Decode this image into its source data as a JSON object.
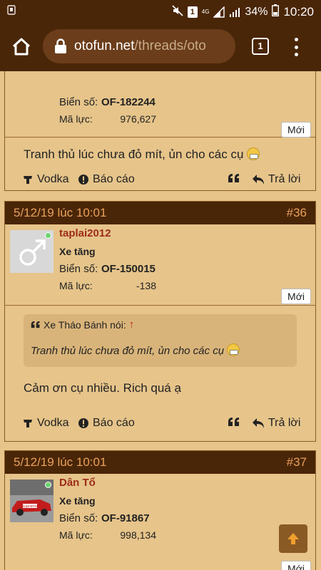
{
  "status": {
    "battery": "34%",
    "time": "10:20",
    "notif_count": "1",
    "network": "4G"
  },
  "browser": {
    "url_host": "otofun.net",
    "url_path": "/threads/oto",
    "tab_count": "1"
  },
  "posts": [
    {
      "plate_label": "Biển số:",
      "plate": "OF-182244",
      "hp_label": "Mã lực:",
      "hp": "976,627",
      "new_badge": "Mới",
      "message": "Tranh thủ lúc chưa đỏ mít, ủn cho các cụ",
      "vodka": "Vodka",
      "report": "Báo cáo",
      "reply": "Trả lời"
    },
    {
      "date": "5/12/19 lúc 10:01",
      "num": "#36",
      "username": "taplai2012",
      "title": "Xe tăng",
      "plate_label": "Biển số:",
      "plate": "OF-150015",
      "hp_label": "Mã lực:",
      "hp": "-138",
      "new_badge": "Mới",
      "quote_author": "Xe Tháo Bánh nói:",
      "quote_text": "Tranh thủ lúc chưa đỏ mít, ủn cho các cụ",
      "message": "Cảm ơn cụ nhiều. Rich quá ạ",
      "vodka": "Vodka",
      "report": "Báo cáo",
      "reply": "Trả lời"
    },
    {
      "date": "5/12/19 lúc 10:01",
      "num": "#37",
      "username": "Dân Tổ",
      "title": "Xe tăng",
      "plate_label": "Biển số:",
      "plate": "OF-91867",
      "hp_label": "Mã lực:",
      "hp": "998,134",
      "new_badge": "Mới",
      "avatar_text": "Supreme"
    }
  ],
  "colors": {
    "header": "#4a2608",
    "background": "#e6c48a",
    "username": "#9c2b1a",
    "post_number": "#e8a15c"
  }
}
